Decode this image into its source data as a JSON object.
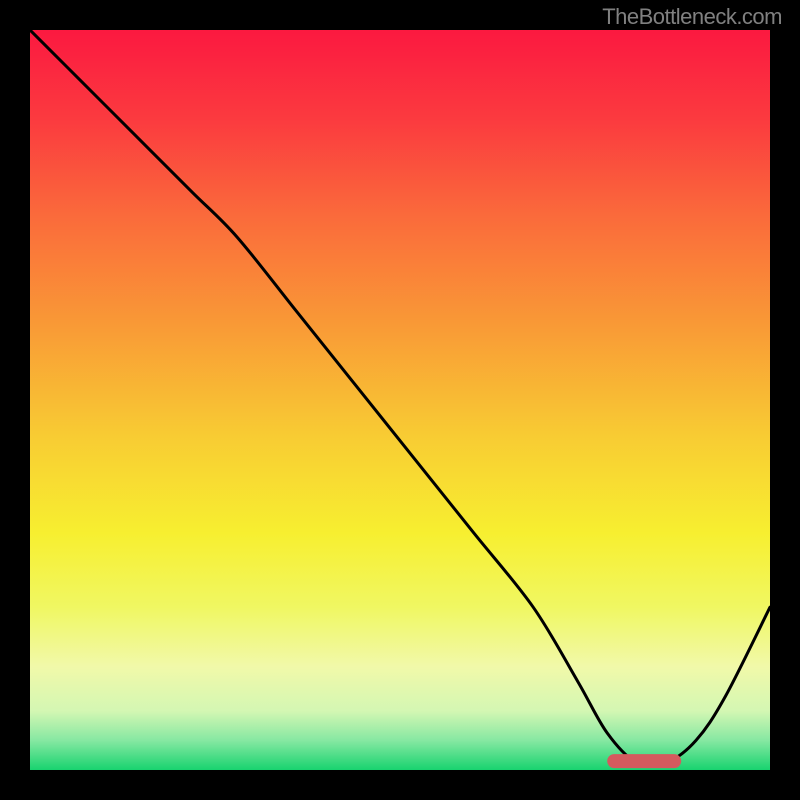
{
  "attribution": "TheBottleneck.com",
  "colors": {
    "bg": "#000000",
    "attribution_text": "#808080",
    "curve": "#000000",
    "marker": "#d45a5e",
    "gradient_stops": [
      {
        "offset": 0.0,
        "color": "#fb1940"
      },
      {
        "offset": 0.12,
        "color": "#fb3a3f"
      },
      {
        "offset": 0.25,
        "color": "#fa6a3b"
      },
      {
        "offset": 0.4,
        "color": "#f99a36"
      },
      {
        "offset": 0.55,
        "color": "#f8cc33"
      },
      {
        "offset": 0.68,
        "color": "#f7ef30"
      },
      {
        "offset": 0.78,
        "color": "#f0f762"
      },
      {
        "offset": 0.86,
        "color": "#f1f9a9"
      },
      {
        "offset": 0.92,
        "color": "#d4f7b3"
      },
      {
        "offset": 0.96,
        "color": "#86e8a2"
      },
      {
        "offset": 1.0,
        "color": "#18d36f"
      }
    ]
  },
  "chart_data": {
    "type": "line",
    "title": "",
    "xlabel": "",
    "ylabel": "",
    "xlim": [
      0,
      100
    ],
    "ylim": [
      0,
      100
    ],
    "grid": false,
    "legend": false,
    "annotations": [
      "TheBottleneck.com"
    ],
    "x": [
      0,
      5,
      10,
      16,
      22,
      28,
      36,
      44,
      52,
      60,
      68,
      74,
      78,
      82,
      86,
      90,
      94,
      100
    ],
    "values": [
      100,
      95,
      90,
      84,
      78,
      72,
      62,
      52,
      42,
      32,
      22,
      12,
      5,
      1,
      1,
      4,
      10,
      22
    ],
    "marker_region": {
      "x_start": 78,
      "x_end": 88,
      "y": 1.2
    }
  }
}
